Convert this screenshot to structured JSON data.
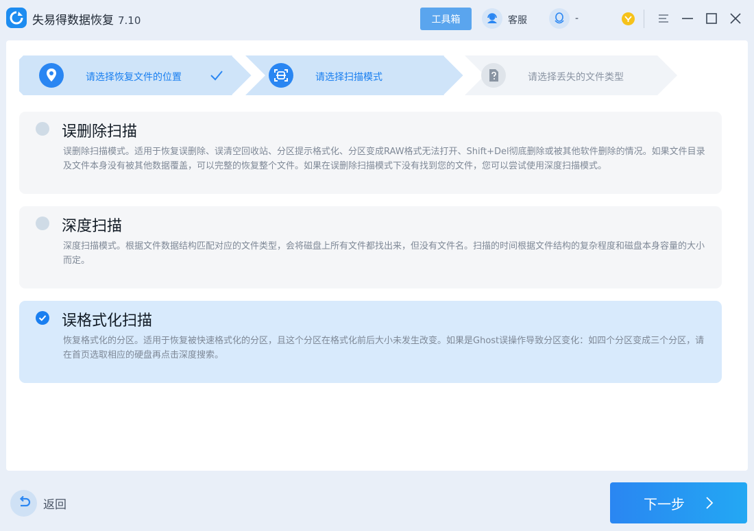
{
  "app": {
    "name": "失易得数据恢复",
    "version": "7.10"
  },
  "titlebar": {
    "toolbox_label": "工具箱",
    "service_label": "客服",
    "qq_label": "-",
    "icons": [
      "app-logo-icon",
      "headset-icon",
      "qq-penguin-icon",
      "coin-icon",
      "menu-icon",
      "minimize-icon",
      "maximize-icon",
      "close-icon"
    ]
  },
  "steps": [
    {
      "label": "请选择恢复文件的位置",
      "state": "done",
      "icon": "location-pin-icon"
    },
    {
      "label": "请选择扫描模式",
      "state": "active",
      "icon": "scan-icon"
    },
    {
      "label": "请选择丢失的文件类型",
      "state": "pending",
      "icon": "question-file-icon"
    }
  ],
  "options": [
    {
      "title": "误删除扫描",
      "description": "误删除扫描模式。适用于恢复误删除、误清空回收站、分区提示格式化、分区变成RAW格式无法打开、Shift+Del彻底删除或被其他软件删除的情况。如果文件目录及文件本身没有被其他数据覆盖，可以完整的恢复整个文件。如果在误删除扫描模式下没有找到您的文件，您可以尝试使用深度扫描模式。",
      "selected": false
    },
    {
      "title": "深度扫描",
      "description": "深度扫描模式。根据文件数据结构匹配对应的文件类型，会将磁盘上所有文件都找出来，但没有文件名。扫描的时间根据文件结构的复杂程度和磁盘本身容量的大小而定。",
      "selected": false
    },
    {
      "title": "误格式化扫描",
      "description": "恢复格式化的分区。适用于恢复被快速格式化的分区，且这个分区在格式化前后大小未发生改变。如果是Ghost误操作导致分区变化：如四个分区变成三个分区，请在首页选取相应的硬盘再点击深度搜索。",
      "selected": true
    }
  ],
  "footer": {
    "back_label": "返回",
    "next_label": "下一步"
  },
  "colors": {
    "accent": "#1d8cf0",
    "step_active_bg": "#cfe4f9",
    "selected_option_bg": "#d8eafc"
  }
}
